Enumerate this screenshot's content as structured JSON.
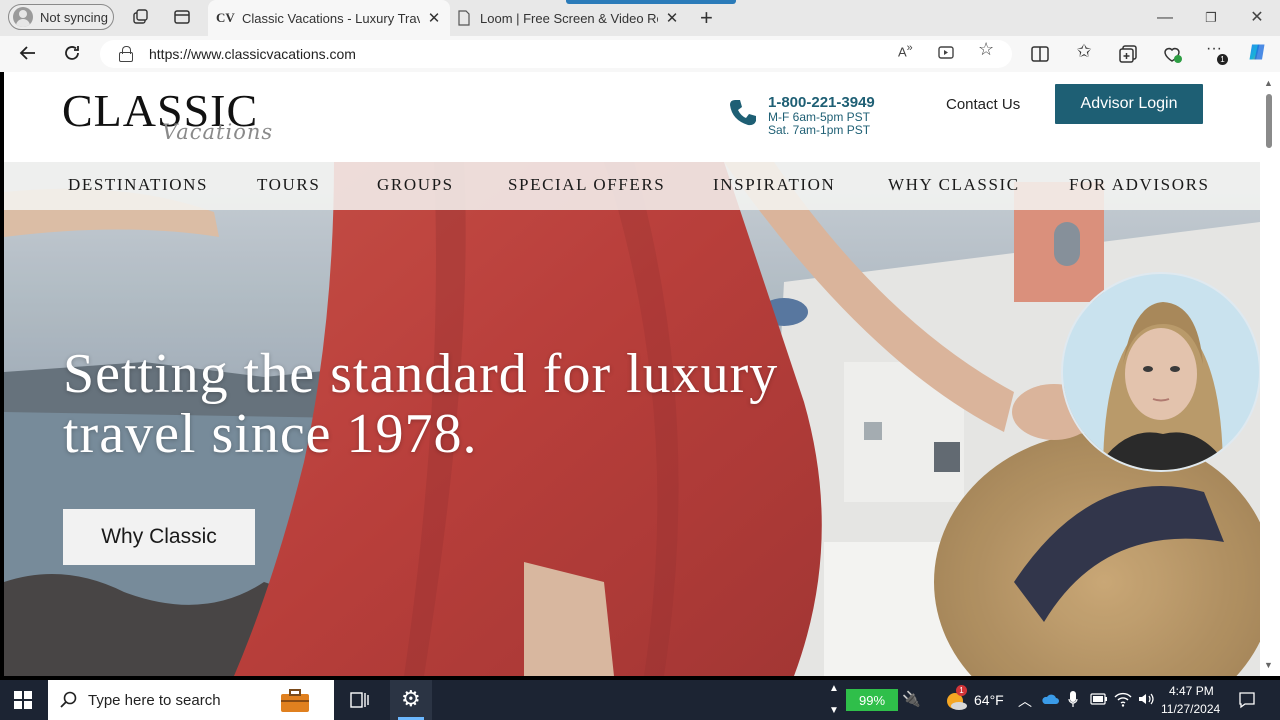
{
  "browser": {
    "profile_label": "Not syncing",
    "tabs": [
      {
        "favicon": "CV",
        "title": "Classic Vacations - Luxury Travel S",
        "active": true
      },
      {
        "favicon": "page-icon",
        "title": "Loom | Free Screen & Video Recor",
        "active": false
      }
    ],
    "url": "https://www.classicvacations.com"
  },
  "site": {
    "logo": {
      "main": "CLASSIC",
      "sub": "Vacations"
    },
    "phone": {
      "number": "1-800-221-3949",
      "hours_weekday": "M-F 6am-5pm PST",
      "hours_sat": "Sat. 7am-1pm PST"
    },
    "contact_label": "Contact Us",
    "advisor_login_label": "Advisor Login",
    "nav": [
      "DESTINATIONS",
      "TOURS",
      "GROUPS",
      "SPECIAL OFFERS",
      "INSPIRATION",
      "WHY CLASSIC",
      "FOR ADVISORS"
    ],
    "hero": {
      "headline_line1": "Setting the standard for luxury",
      "headline_line2": "travel since 1978.",
      "cta_label": "Why Classic"
    }
  },
  "taskbar": {
    "search_placeholder": "Type here to search",
    "battery_level": 99,
    "battery_label": "99%",
    "weather_temp": "64°F",
    "weather_badge": "1",
    "time": "4:47 PM",
    "date": "11/27/2024"
  },
  "colors": {
    "brand_teal": "#1e5f74",
    "battery_green": "#2fbf4a",
    "taskbar_bg": "#1c2433"
  }
}
